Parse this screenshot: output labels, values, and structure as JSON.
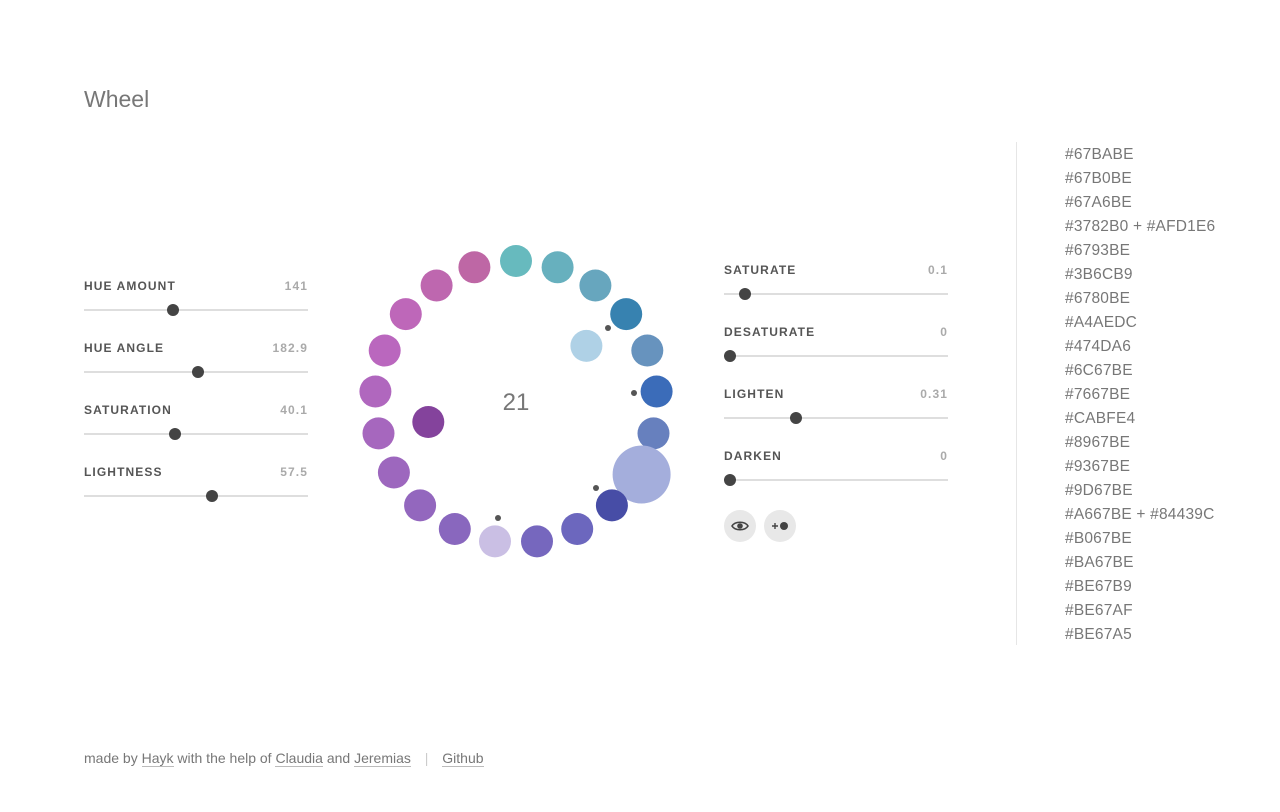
{
  "page": {
    "title": "Wheel"
  },
  "left_sliders": [
    {
      "label": "HUE AMOUNT",
      "value": "141",
      "fraction": 0.397
    },
    {
      "label": "HUE ANGLE",
      "value": "182.9",
      "fraction": 0.509
    },
    {
      "label": "SATURATION",
      "value": "40.1",
      "fraction": 0.406
    },
    {
      "label": "LIGHTNESS",
      "value": "57.5",
      "fraction": 0.571
    }
  ],
  "right_sliders": [
    {
      "label": "SATURATE",
      "value": "0.1",
      "fraction": 0.094
    },
    {
      "label": "DESATURATE",
      "value": "0",
      "fraction": 0.027
    },
    {
      "label": "LIGHTEN",
      "value": "0.31",
      "fraction": 0.321
    },
    {
      "label": "DARKEN",
      "value": "0",
      "fraction": 0.027
    }
  ],
  "wheel": {
    "count": "21",
    "colors": [
      "#67BABE",
      "#67B0BE",
      "#67A6BE",
      "#3782B0",
      "#6793BE",
      "#3B6CB9",
      "#6780BE",
      "#A4AEDC",
      "#474DA6",
      "#6C67BE",
      "#7667BE",
      "#CABFE4",
      "#8967BE",
      "#9367BE",
      "#9D67BE",
      "#A667BE",
      "#B067BE",
      "#BA67BE",
      "#BE67B9",
      "#BE67AF",
      "#BE67A5"
    ],
    "inner": [
      {
        "index": 3,
        "color": "#AFD1E6"
      },
      {
        "index": 15,
        "color": "#84439C"
      }
    ]
  },
  "hex_list": [
    "#67BABE",
    "#67B0BE",
    "#67A6BE",
    "#3782B0 + #AFD1E6",
    "#6793BE",
    "#3B6CB9",
    "#6780BE",
    "#A4AEDC",
    "#474DA6",
    "#6C67BE",
    "#7667BE",
    "#CABFE4",
    "#8967BE",
    "#9367BE",
    "#9D67BE",
    "#A667BE + #84439C",
    "#B067BE",
    "#BA67BE",
    "#BE67B9",
    "#BE67AF",
    "#BE67A5"
  ],
  "footer": {
    "made_by": "made by",
    "hayk": "Hayk",
    "with_help": "with the help of",
    "claudia": "Claudia",
    "and": "and",
    "jeremias": "Jeremias",
    "separator": "|",
    "github": "Github"
  },
  "buttons": {
    "eye_icon": "eye-icon",
    "add_icon": "add-color-icon"
  }
}
